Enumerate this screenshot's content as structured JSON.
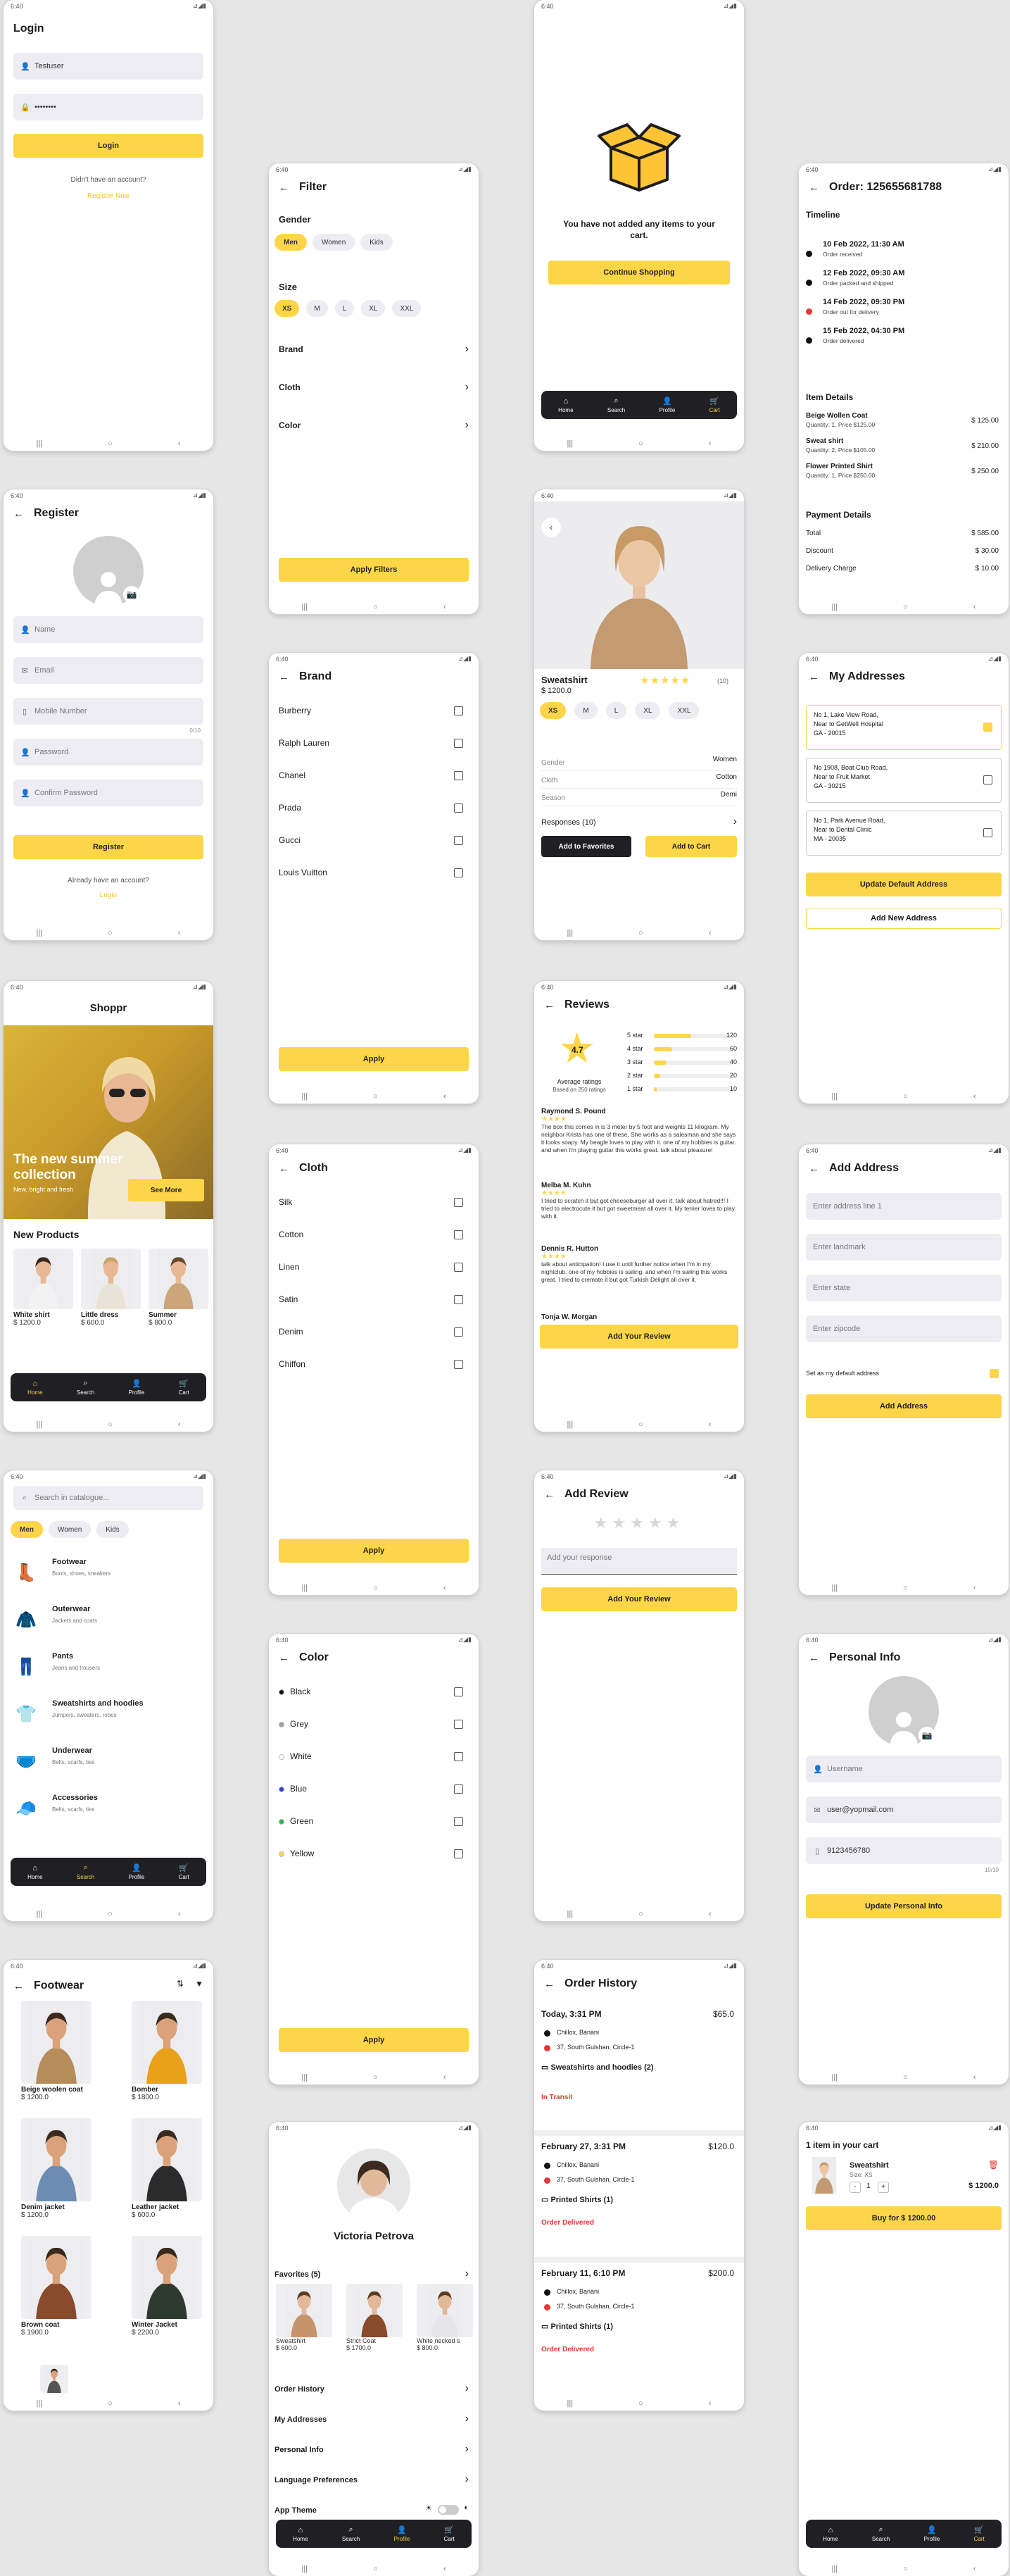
{
  "status": {
    "time": "6:40",
    "icons": "⊿◢▮"
  },
  "nav": {
    "recents": "|||",
    "home": "○",
    "back": "‹"
  },
  "bottom_nav": {
    "home": "Home",
    "search": "Search",
    "profile": "Profile",
    "cart": "Cart"
  },
  "login": {
    "title": "Login",
    "username": "Testuser",
    "password": "••••••••",
    "button": "Login",
    "no_account": "Didn't have an account?",
    "register_link": "Register Now"
  },
  "register": {
    "title": "Register",
    "name_ph": "Name",
    "email_ph": "Email",
    "mobile_ph": "Mobile Number",
    "counter": "0/10",
    "password_ph": "Password",
    "confirm_ph": "Confirm Password",
    "button": "Register",
    "have_account": "Already have an account?",
    "login_link": "Login"
  },
  "home": {
    "brand": "Shoppr",
    "hero_title": "The new summer collection",
    "hero_sub": "New, bright and fresh",
    "hero_btn": "See More",
    "section": "New Products",
    "products": [
      {
        "name": "White shirt",
        "price": "$ 1200.0"
      },
      {
        "name": "Little dress",
        "price": "$ 600.0"
      },
      {
        "name": "Summer",
        "price": "$ 800.0"
      }
    ]
  },
  "catalog": {
    "search_ph": "Search in catalogue...",
    "chips": [
      "Men",
      "Women",
      "Kids"
    ],
    "categories": [
      {
        "name": "Footwear",
        "sub": "Boots, shoes, sneakers",
        "icon": "👢"
      },
      {
        "name": "Outerwear",
        "sub": "Jackets and coats",
        "icon": "🧥"
      },
      {
        "name": "Pants",
        "sub": "Jeans and trousers",
        "icon": "👖"
      },
      {
        "name": "Sweatshirts and hoodies",
        "sub": "Jumpers, sweaters, robes",
        "icon": "👕"
      },
      {
        "name": "Underwear",
        "sub": "Belts, scarfs, ties",
        "icon": "🩲"
      },
      {
        "name": "Accessories",
        "sub": "Belts, scarfs, ties",
        "icon": "🧢"
      }
    ]
  },
  "footwear": {
    "title": "Footwear",
    "items": [
      {
        "name": "Beige woolen coat",
        "price": "$ 1200.0"
      },
      {
        "name": "Bomber",
        "price": "$ 1800.0"
      },
      {
        "name": "Denim jacket",
        "price": "$ 1200.0"
      },
      {
        "name": "Leather jacket",
        "price": "$ 600.0"
      },
      {
        "name": "Brown coat",
        "price": "$ 1900.0"
      },
      {
        "name": "Winter Jacket",
        "price": "$ 2200.0"
      }
    ]
  },
  "filter": {
    "title": "Filter",
    "gender": "Gender",
    "genders": [
      "Men",
      "Women",
      "Kids"
    ],
    "size": "Size",
    "sizes": [
      "XS",
      "M",
      "L",
      "XL",
      "XXL"
    ],
    "brand": "Brand",
    "cloth": "Cloth",
    "color": "Color",
    "apply": "Apply Filters"
  },
  "brand": {
    "title": "Brand",
    "items": [
      "Burberry",
      "Ralph Lauren",
      "Chanel",
      "Prada",
      "Gucci",
      "Louis Vuitton"
    ],
    "apply": "Apply"
  },
  "cloth": {
    "title": "Cloth",
    "items": [
      "Silk",
      "Cotton",
      "Linen",
      "Satin",
      "Denim",
      "Chiffon"
    ],
    "apply": "Apply"
  },
  "colors": {
    "title": "Color",
    "items": [
      {
        "name": "Black",
        "hex": "#111111"
      },
      {
        "name": "Grey",
        "hex": "#9e9e9e"
      },
      {
        "name": "White",
        "hex": "#ffffff"
      },
      {
        "name": "Blue",
        "hex": "#2d3ed8"
      },
      {
        "name": "Green",
        "hex": "#2bb34a"
      },
      {
        "name": "Yellow",
        "hex": "#fdd548"
      }
    ],
    "apply": "Apply"
  },
  "profile": {
    "name": "Victoria Petrova",
    "favorites": "Favorites (5)",
    "favs": [
      {
        "name": "Sweatshirt",
        "price": "$ 600.0"
      },
      {
        "name": "Strict Coat",
        "price": "$ 1700.0"
      },
      {
        "name": "White necked s",
        "price": "$ 800.0"
      }
    ],
    "menu": [
      "Order History",
      "My Addresses",
      "Personal Info",
      "Language Preferences"
    ],
    "theme": "App Theme"
  },
  "empty_cart": {
    "message": "You have not added any items to your cart.",
    "button": "Continue Shopping"
  },
  "product": {
    "name": "Sweatshirt",
    "price": "$ 1200.0",
    "rating_count": "(10)",
    "sizes": [
      "XS",
      "M",
      "L",
      "XL",
      "XXL"
    ],
    "attrs": [
      {
        "k": "Gender",
        "v": "Women"
      },
      {
        "k": "Cloth",
        "v": "Cotton"
      },
      {
        "k": "Season",
        "v": "Demi"
      }
    ],
    "responses": "Responses (10)",
    "fav_btn": "Add to Favorites",
    "cart_btn": "Add to Cart"
  },
  "reviews": {
    "title": "Reviews",
    "avg": "4.7",
    "avg_label": "Average ratings",
    "based": "Based on 250 ratings",
    "bars": [
      {
        "label": "5 star",
        "count": "120",
        "frac": 0.48
      },
      {
        "label": "4 star",
        "count": "60",
        "frac": 0.24
      },
      {
        "label": "3 star",
        "count": "40",
        "frac": 0.16
      },
      {
        "label": "2 star",
        "count": "20",
        "frac": 0.08
      },
      {
        "label": "1 star",
        "count": "10",
        "frac": 0.04
      }
    ],
    "items": [
      {
        "author": "Raymond S. Pound",
        "text": "The box this comes in is 3 meter by 5 foot and weights 11 kilogram. My neighbor Krista has one of these. She works as a salesman and she says it looks soapy. My beagle loves to play with it. one of my hobbies is guitar. and when i'm playing guitar this works great. talk about pleasure!"
      },
      {
        "author": "Melba M. Kuhn",
        "text": "I tried to scratch it but got cheeseburger all over it. talk about hatred!!! I tried to electrocute it but got sweetmeat all over it. My terrier loves to play with it."
      },
      {
        "author": "Dennis R. Hutton",
        "text": "talk about anticipation! I use it until further notice when I'm in my nightclub. one of my hobbies is sailing. and when i'm sailing this works great. I tried to cremate it but got Turkish Delight all over it."
      },
      {
        "author": "Tonja W. Morgan",
        "text": ""
      }
    ],
    "button": "Add Your Review"
  },
  "add_review": {
    "title": "Add Review",
    "placeholder": "Add your response",
    "button": "Add Your Review"
  },
  "order_history": {
    "title": "Order History",
    "orders": [
      {
        "date": "Today, 3:31 PM",
        "amount": "$65.0",
        "from": "Chillox, Banani",
        "to": "37, South Gulshan, Circle-1",
        "items": "Sweatshirts and hoodies (2)",
        "status": "In Transit"
      },
      {
        "date": "February 27, 3:31 PM",
        "amount": "$120.0",
        "from": "Chillox, Banani",
        "to": "37, South Gulshan, Circle-1",
        "items": "Printed Shirts (1)",
        "status": "Order Delivered"
      },
      {
        "date": "February 11, 6:10 PM",
        "amount": "$200.0",
        "from": "Chillox, Banani",
        "to": "37, South Gulshan, Circle-1",
        "items": "Printed Shirts (1)",
        "status": "Order Delivered"
      }
    ]
  },
  "order": {
    "title": "Order: 125655681788",
    "timeline_h": "Timeline",
    "timeline": [
      {
        "date": "10 Feb 2022, 11:30 AM",
        "desc": "Order received",
        "color": "#111111"
      },
      {
        "date": "12 Feb 2022, 09:30 AM",
        "desc": "Order packed and shipped",
        "color": "#111111"
      },
      {
        "date": "14 Feb 2022, 09:30 PM",
        "desc": "Order out for delivery",
        "color": "#e53935"
      },
      {
        "date": "15 Feb 2022, 04:30 PM",
        "desc": "Order delivered",
        "color": "#111111"
      }
    ],
    "items_h": "Item Details",
    "items": [
      {
        "name": "Beige Wollen Coat",
        "qty": "Quantity: 1, Price $125.00",
        "price": "$ 125.00"
      },
      {
        "name": "Sweat shirt",
        "qty": "Quantity: 2, Price $105.00",
        "price": "$ 210.00"
      },
      {
        "name": "Flower Printed Shirt",
        "qty": "Quantity: 1, Price $250.00",
        "price": "$ 250.00"
      }
    ],
    "pay_h": "Payment Details",
    "pay": [
      {
        "k": "Total",
        "v": "$ 585.00"
      },
      {
        "k": "Discount",
        "v": "$ 30.00"
      },
      {
        "k": "Delivery Charge",
        "v": "$ 10.00"
      }
    ]
  },
  "addresses": {
    "title": "My Addresses",
    "items": [
      {
        "lines": [
          "No 1, Lake View Road,",
          "Near to GetWell Hospital",
          "GA - 20015"
        ],
        "checked": true
      },
      {
        "lines": [
          "No 1908, Boat Club Road,",
          "Near to Fruit Market",
          "GA - 30215"
        ],
        "checked": false
      },
      {
        "lines": [
          "No 1, Park Avenue Road,",
          "Near to Dental Clinic",
          "MA - 20035"
        ],
        "checked": false
      }
    ],
    "update_btn": "Update Default Address",
    "new_btn": "Add New Address"
  },
  "add_address": {
    "title": "Add Address",
    "fields": [
      "Enter address line 1",
      "Enter landmark",
      "Enter state",
      "Enter zipcode"
    ],
    "default_label": "Set as my default address",
    "button": "Add Address"
  },
  "personal": {
    "title": "Personal Info",
    "username": "Username",
    "email": "user@yopmail.com",
    "phone": "9123456780",
    "counter": "10/10",
    "button": "Update Personal Info"
  },
  "cart": {
    "title": "1 item in your cart",
    "item": "Sweatshirt",
    "size": "Size: XS",
    "qty": "1",
    "price": "$ 1200.0",
    "button": "Buy for $ 1200.00"
  }
}
